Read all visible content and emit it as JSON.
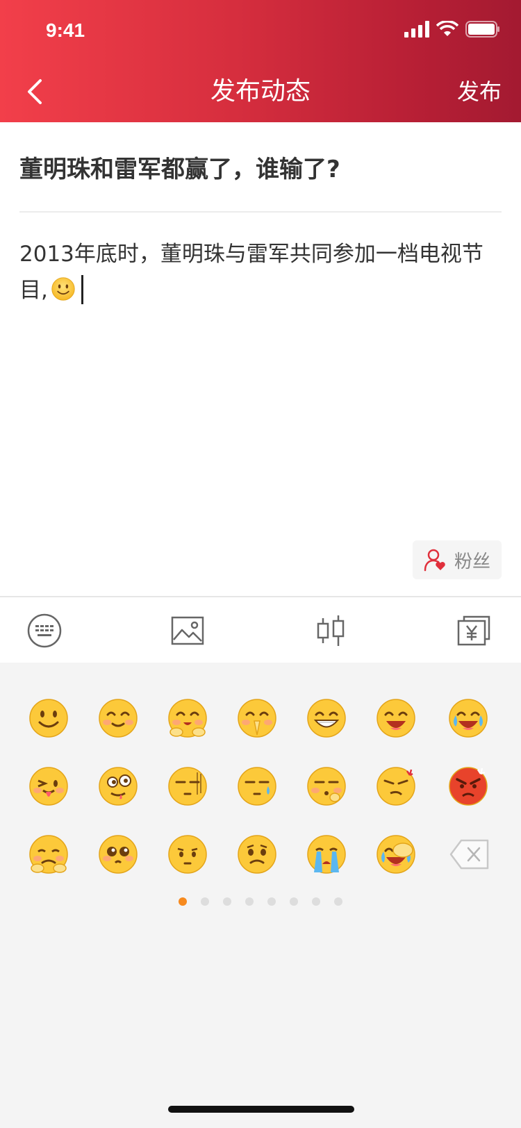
{
  "status": {
    "time": "9:41"
  },
  "nav": {
    "title": "发布动态",
    "action": "发布"
  },
  "post": {
    "title": "董明珠和雷军都赢了，谁输了?",
    "body": "2013年底时，董明珠与雷军共同参加一档电视节目,"
  },
  "fans_chip": {
    "label": "粉丝"
  },
  "toolbar": {
    "items": [
      "keyboard-icon",
      "image-icon",
      "candlestick-icon",
      "yen-card-icon"
    ]
  },
  "emoji_panel": {
    "emojis": [
      "smile",
      "blush",
      "hug",
      "pray",
      "grin",
      "laugh",
      "tears-of-joy",
      "tongue-wink",
      "drool",
      "speechless",
      "sweat",
      "shush",
      "smirk-angry",
      "angry",
      "shy",
      "pleading",
      "sad",
      "worried",
      "crying",
      "facepalm"
    ],
    "delete": "backspace-icon",
    "page_count": 8,
    "current_page": 1
  },
  "colors": {
    "header_start": "#f23f4a",
    "header_end": "#a31a31",
    "dot_active": "#f78a1e",
    "emoji_face": "#fcc93a"
  }
}
